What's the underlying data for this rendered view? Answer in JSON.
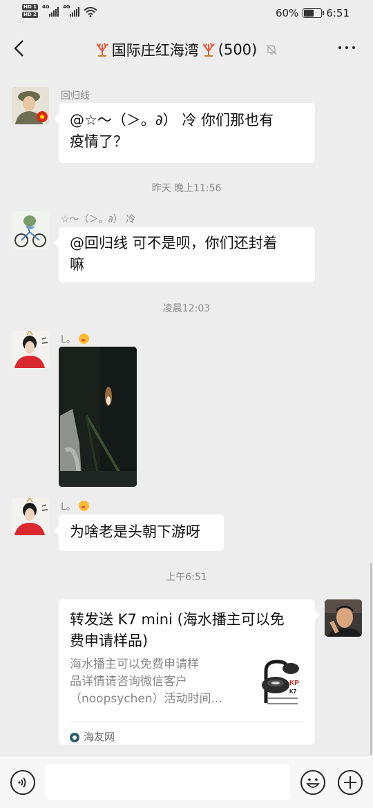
{
  "status_bar": {
    "hd1": "HD 1",
    "hd2": "HD 2",
    "net1": "4G",
    "net2": "4G",
    "battery_percent": "60%",
    "battery_level": 0.6,
    "time": "6:51",
    "wifi_icon": "wifi-icon"
  },
  "header": {
    "title": "国际庄红海湾",
    "count": "(500)",
    "icons": [
      "back-arrow-icon",
      "coral-icon",
      "mute-bell-icon",
      "more-icon"
    ]
  },
  "messages": [
    {
      "sender": "回归线",
      "text_line1": "@☆～（＞。∂） 冷 你们那也有",
      "text_line2": "疫情了？"
    },
    {
      "timestamp": "昨天 晚上11:56"
    },
    {
      "sender": "☆～（＞。∂） 冷",
      "text_line1": "@回归线  可不是呗，你们还封着",
      "text_line2": "嘛"
    },
    {
      "timestamp": "凌晨12:03"
    },
    {
      "sender": "L。",
      "type": "image"
    },
    {
      "sender": "L。",
      "text": "为啥老是头朝下游呀"
    },
    {
      "timestamp": "上午6:51"
    },
    {
      "sender": "self",
      "card": {
        "title_line1": "转发送 K7 mini (海水播主可以免",
        "title_line2": "费申请样品)",
        "desc_line1": "海水播主可以免费申请样",
        "desc_line2": "品详情请咨询微信客户",
        "desc_line3": "（noopsychen）活动时间...",
        "source": "海友网",
        "thumb_brand": "K7",
        "thumb_logo": "KP"
      }
    }
  ],
  "input_bar": {
    "voice_icon": "voice-icon",
    "emoji_icon": "emoji-icon",
    "plus_icon": "plus-icon",
    "placeholder": ""
  },
  "colors": {
    "background": "#ededed",
    "bubble": "#ffffff",
    "muted_text": "#8a8a8a"
  }
}
